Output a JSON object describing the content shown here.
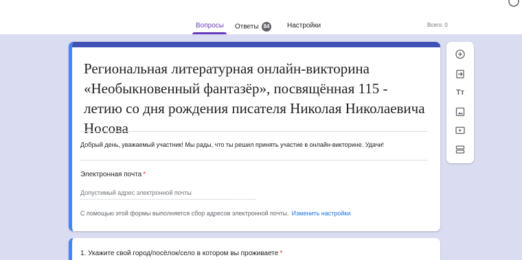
{
  "tabs": [
    {
      "label": "Вопросы",
      "active": true
    },
    {
      "label": "Ответы",
      "badge": "84"
    },
    {
      "label": "Настройки"
    }
  ],
  "total": "Всего: 0",
  "form": {
    "title": "Региональная литературная онлайн-викторина «Необыкновенный фантазёр», посвящённая 115 - летию со дня рождения писателя Николая Николаевича Носова",
    "description": "Добрый день, уважаемый участник! Мы рады, что ты решил принять участие в онлайн-викторине. Удачи!",
    "email_label": "Электронная почта",
    "required_mark": "*",
    "email_placeholder": "Допустимый адрес электронной почты",
    "collect_note": "С помощью этой формы выполняется сбор адресов электронной почты.",
    "change_settings": "Изменить настройки"
  },
  "question": {
    "text": "1. Укажите свой город/посёлок/село в котором вы проживаете",
    "required_mark": "*"
  },
  "toolbar": {
    "icons": [
      "add-question-icon",
      "import-questions-icon",
      "add-title-icon",
      "add-image-icon",
      "add-video-icon",
      "add-section-icon"
    ],
    "title_icon_text": "Тт"
  },
  "colors": {
    "accent": "#673ab7",
    "header_bar": "#3f51b5",
    "card_border": "#4285f4",
    "background": "#dadcf2",
    "link": "#1a73e8"
  }
}
